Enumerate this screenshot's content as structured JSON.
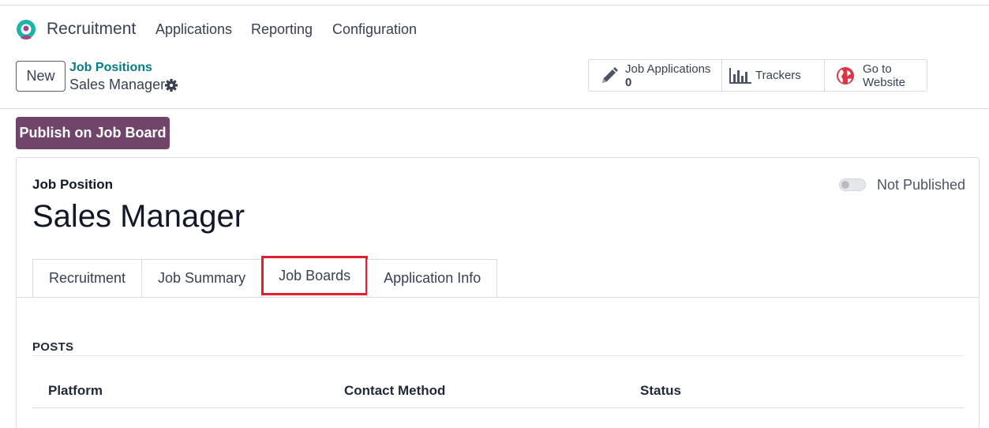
{
  "navbar": {
    "app_name": "Recruitment",
    "menu": [
      "Applications",
      "Reporting",
      "Configuration"
    ]
  },
  "control_panel": {
    "new_label": "New",
    "breadcrumb_parent": "Job Positions",
    "breadcrumb_current": "Sales Manager",
    "stat_buttons": {
      "applications": {
        "label": "Job Applications",
        "value": "0",
        "icon": "pencil-icon"
      },
      "trackers": {
        "label": "Trackers",
        "icon": "bar-chart-icon"
      },
      "website": {
        "label_line1": "Go to",
        "label_line2": "Website",
        "icon": "globe-icon"
      }
    }
  },
  "actions": {
    "publish_label": "Publish on Job Board"
  },
  "form": {
    "field_label": "Job Position",
    "job_title": "Sales Manager",
    "publish_state": "Not Published",
    "tabs": [
      "Recruitment",
      "Job Summary",
      "Job Boards",
      "Application Info"
    ],
    "active_tab": "Job Boards",
    "section_title": "POSTS",
    "columns": [
      "Platform",
      "Contact Method",
      "Status"
    ]
  },
  "colors": {
    "primary": "#71456a",
    "link": "#017e84",
    "highlight": "#e0202e"
  }
}
